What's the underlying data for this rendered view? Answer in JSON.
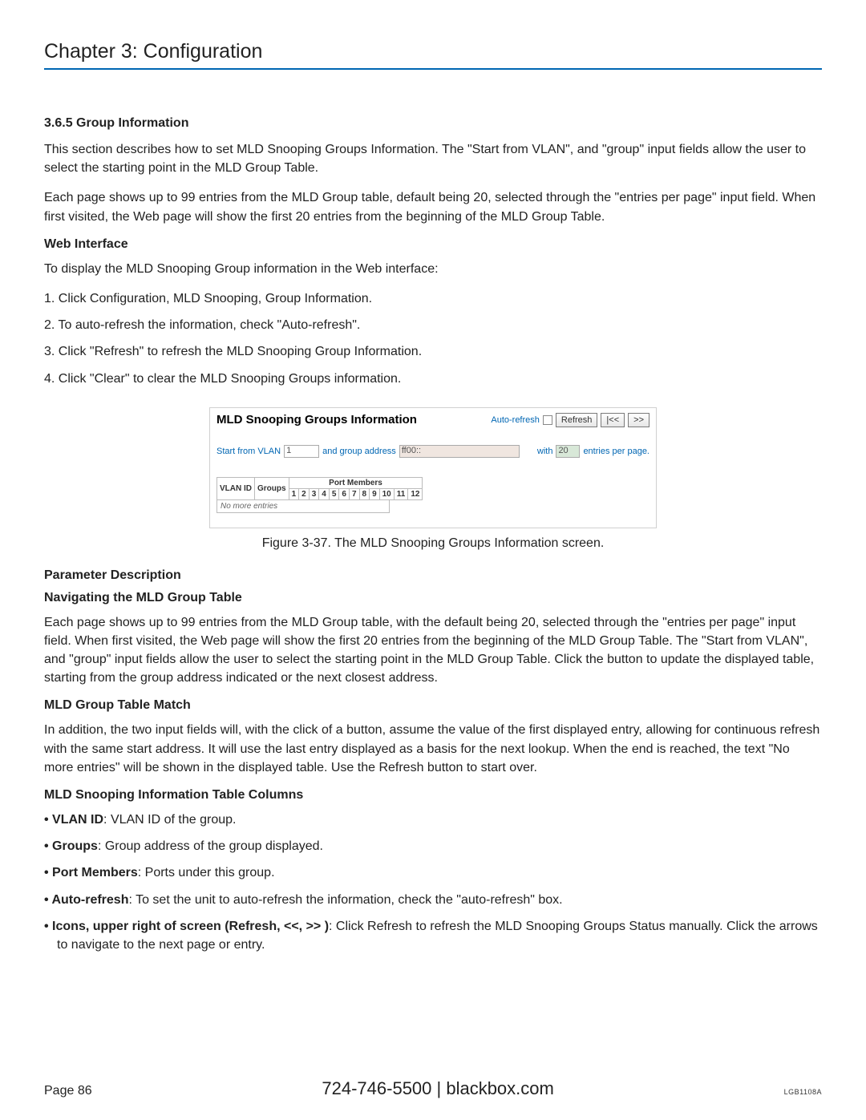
{
  "chapter": "Chapter 3: Configuration",
  "section": "3.6.5 Group Information",
  "intro1": "This section describes how to set MLD Snooping Groups Information. The \"Start from VLAN\", and \"group\" input fields allow the user to select the starting point in the MLD Group Table.",
  "intro2": "Each page shows up to 99 entries from the MLD Group table, default being 20, selected through the \"entries per page\" input field. When first visited, the Web page will show the first 20 entries from the beginning of the MLD Group Table.",
  "web_interface_heading": "Web Interface",
  "web_interface_lead": "To display the MLD Snooping Group information in the Web interface:",
  "steps": {
    "s1": "1. Click Configuration, MLD Snooping, Group Information.",
    "s2": "2. To auto-refresh the information, check \"Auto-refresh\".",
    "s3": "3. Click \"Refresh\" to refresh the MLD Snooping Group Information.",
    "s4": "4. Click \"Clear\" to clear the MLD Snooping Groups information."
  },
  "figure_caption": "Figure 3-37. The MLD Snooping Groups Information screen.",
  "embedded": {
    "title": "MLD Snooping Groups Information",
    "auto_refresh_label": "Auto-refresh",
    "refresh_btn": "Refresh",
    "prev_btn": "|<<",
    "next_btn": ">>",
    "start_vlan_label": "Start from VLAN",
    "start_vlan_value": "1",
    "group_label": "and group address",
    "group_value": "ff00::",
    "with_label": "with",
    "entries_value": "20",
    "entries_label": "entries per page.",
    "col_vlan": "VLAN ID",
    "col_groups": "Groups",
    "pm_header": "Port Members",
    "ports": [
      "1",
      "2",
      "3",
      "4",
      "5",
      "6",
      "7",
      "8",
      "9",
      "10",
      "11",
      "12"
    ],
    "no_more": "No more entries"
  },
  "pd_heading": "Parameter Description",
  "nav_heading": "Navigating the MLD Group Table",
  "nav_text": "Each page shows up to 99 entries from the MLD Group table, with the default being 20, selected through the \"entries per page\" input field. When first visited, the Web page will show the first 20 entries from the beginning of the MLD Group Table. The \"Start from VLAN\", and \"group\" input fields allow the user to select the starting point in the MLD Group Table. Click the button to update the displayed table, starting from the group address indicated or the next closest address.",
  "match_heading": "MLD Group Table Match",
  "match_text": "In addition, the two input fields will, with the click of a button, assume the value of the first displayed entry, allowing for continuous refresh with the same start address. It will use the last entry displayed as a basis for the next lookup. When the end is reached, the text \"No more entries\" will be shown in the displayed table. Use the Refresh button to start over.",
  "cols_heading": "MLD Snooping Information Table Columns",
  "bullets": {
    "b1_label": "• VLAN ID",
    "b1_text": ": VLAN ID of the group.",
    "b2_label": "• Groups",
    "b2_text": ": Group address of the group displayed.",
    "b3_label": "• Port Members",
    "b3_text": ": Ports under this group.",
    "b4_label": "• Auto-refresh",
    "b4_text": ": To set the unit to auto-refresh the information, check the \"auto-refresh\" box.",
    "b5_label": "• Icons, upper right of screen (Refresh, <<, >> )",
    "b5_text": ": Click Refresh to refresh the MLD Snooping Groups Status manually. Click the arrows to navigate to the next page or entry."
  },
  "footer": {
    "page": "Page 86",
    "phone_site": "724-746-5500    |    blackbox.com",
    "model": "LGB1108A"
  }
}
